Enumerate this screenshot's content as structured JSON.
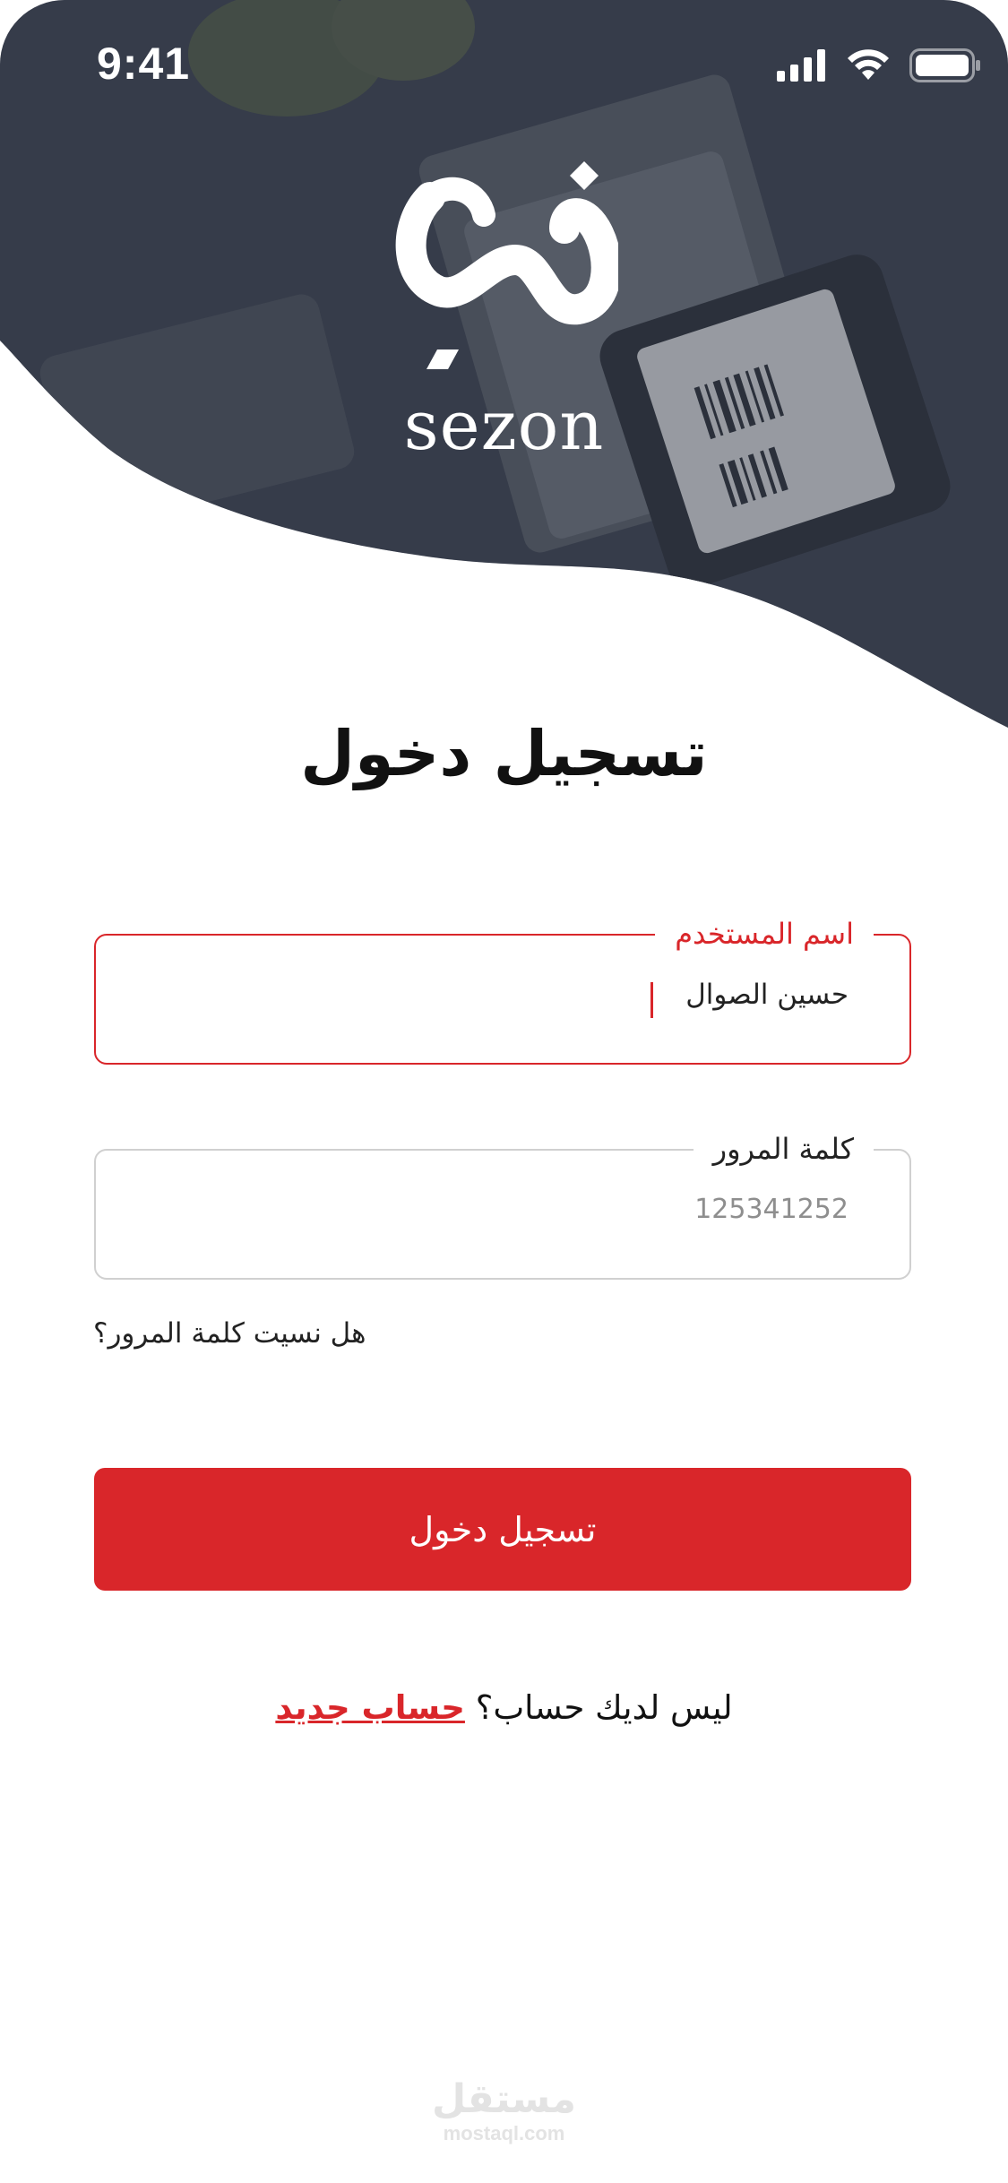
{
  "status_bar": {
    "time": "9:41"
  },
  "brand": {
    "logo_text": "sezon"
  },
  "login": {
    "title": "تسجيل دخول",
    "username": {
      "label": "اسم المستخدم",
      "value": "حسين الصوال"
    },
    "password": {
      "label": "كلمة المرور",
      "placeholder": "125341252"
    },
    "forgot_password": "هل نسيت كلمة المرور؟",
    "submit_label": "تسجيل دخول",
    "no_account_text": "ليس لديك حساب؟",
    "new_account_link": "حساب جديد"
  },
  "watermark": {
    "arabic": "مستقل",
    "latin": "mostaql.com"
  },
  "colors": {
    "accent": "#d9262a",
    "hero_overlay": "#3b4150",
    "text": "#111111",
    "border_inactive": "#d0d0d0"
  }
}
